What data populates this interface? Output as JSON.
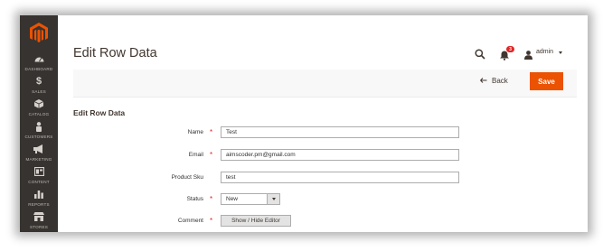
{
  "sidebar": {
    "items": [
      {
        "label": "DASHBOARD",
        "icon": "dashboard-icon"
      },
      {
        "label": "SALES",
        "icon": "dollar-icon"
      },
      {
        "label": "CATALOG",
        "icon": "cube-icon"
      },
      {
        "label": "CUSTOMERS",
        "icon": "person-icon"
      },
      {
        "label": "MARKETING",
        "icon": "megaphone-icon"
      },
      {
        "label": "CONTENT",
        "icon": "layout-icon"
      },
      {
        "label": "REPORTS",
        "icon": "bar-chart-icon"
      },
      {
        "label": "STORES",
        "icon": "store-icon"
      }
    ]
  },
  "header": {
    "title": "Edit Row Data",
    "notification_count": "3",
    "user_label": "admin"
  },
  "actions": {
    "back_label": "Back",
    "save_label": "Save"
  },
  "form": {
    "section_title": "Edit Row Data",
    "required_mark": "*",
    "name_label": "Name",
    "name_value": "Test",
    "email_label": "Email",
    "email_value": "aimscoder.pm@gmail.com",
    "sku_label": "Product Sku",
    "sku_value": "test",
    "status_label": "Status",
    "status_value": "New",
    "comment_label": "Comment",
    "comment_button": "Show / Hide Editor"
  },
  "colors": {
    "sidebar_bg": "#373330",
    "logo": "#eb5202",
    "accent": "#eb5202",
    "required": "#e22626"
  }
}
